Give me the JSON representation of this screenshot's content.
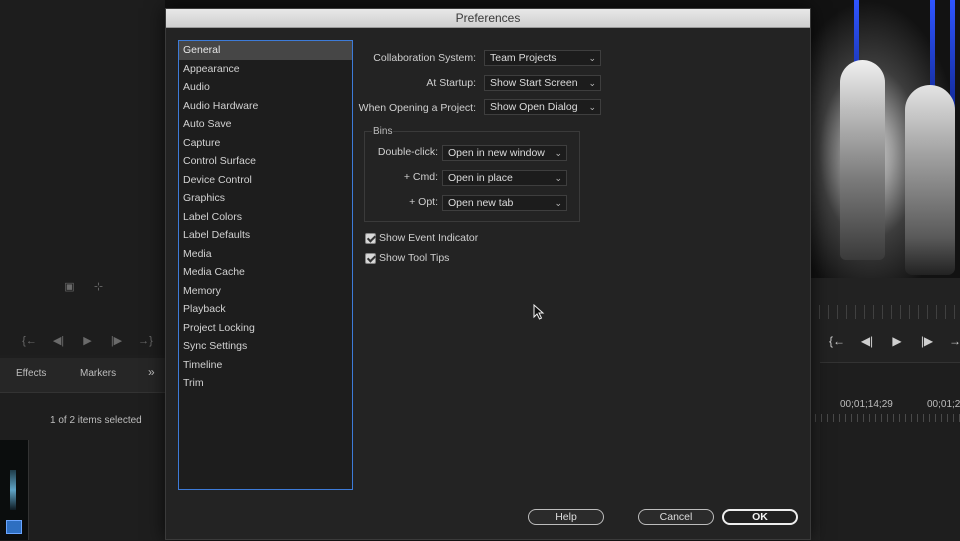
{
  "background": {
    "left_tabs": [
      "Effects",
      "Markers"
    ],
    "tabs_overflow_glyph": "»",
    "selection_status": "1 of 2 items selected",
    "timecode_1": "00;01;14;29",
    "timecode_2": "00;01;2",
    "transport_glyphs": [
      "{←",
      "◀|",
      "▶",
      "|▶",
      "→}"
    ]
  },
  "dialog": {
    "title": "Preferences",
    "categories": [
      "General",
      "Appearance",
      "Audio",
      "Audio Hardware",
      "Auto Save",
      "Capture",
      "Control Surface",
      "Device Control",
      "Graphics",
      "Label Colors",
      "Label Defaults",
      "Media",
      "Media Cache",
      "Memory",
      "Playback",
      "Project Locking",
      "Sync Settings",
      "Timeline",
      "Trim"
    ],
    "selected_category": "General",
    "general": {
      "collaboration": {
        "label": "Collaboration System:",
        "value": "Team Projects"
      },
      "startup": {
        "label": "At Startup:",
        "value": "Show Start Screen"
      },
      "opening_project": {
        "label": "When Opening a Project:",
        "value": "Show Open Dialog"
      },
      "bins": {
        "title": "Bins",
        "double_click": {
          "label": "Double-click:",
          "value": "Open in new window"
        },
        "cmd": {
          "label": "+ Cmd:",
          "value": "Open in place"
        },
        "opt": {
          "label": "+ Opt:",
          "value": "Open new tab"
        }
      },
      "show_event_indicator": {
        "label": "Show Event Indicator",
        "checked": true
      },
      "show_tool_tips": {
        "label": "Show Tool Tips",
        "checked": true
      }
    },
    "buttons": {
      "help": "Help",
      "cancel": "Cancel",
      "ok": "OK"
    }
  },
  "icons": {
    "dropdown": "chevron-down-icon",
    "cursor": "mouse-pointer-icon"
  }
}
